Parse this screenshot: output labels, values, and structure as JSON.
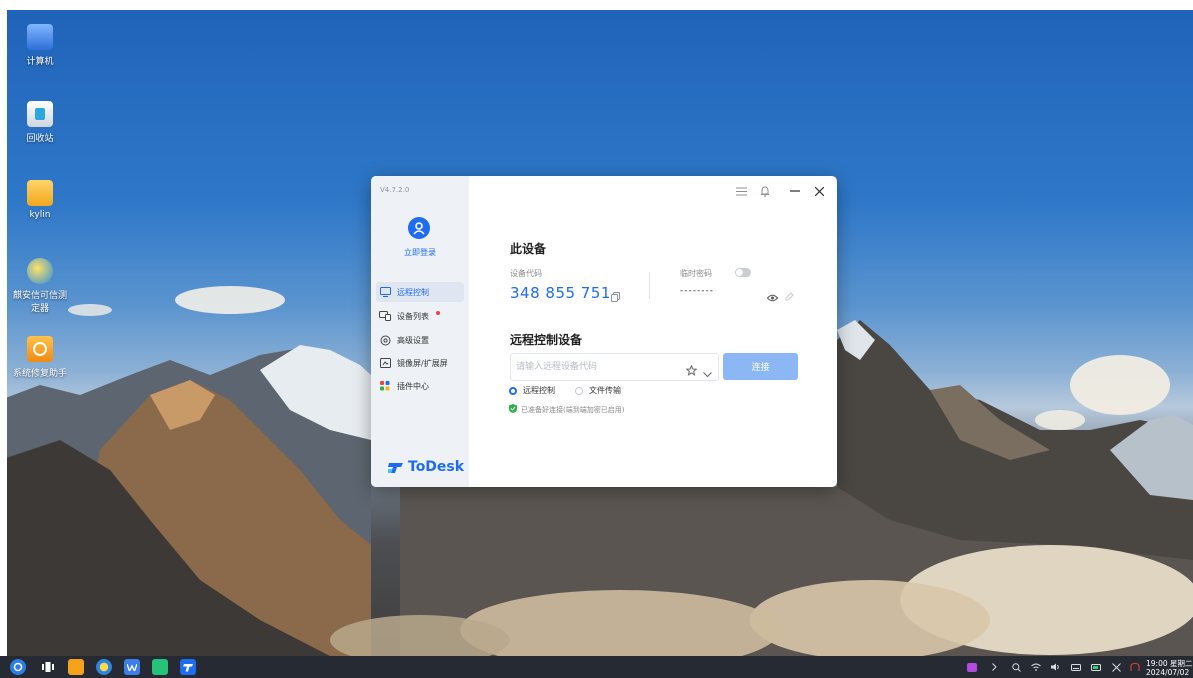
{
  "desktop": {
    "icons": [
      {
        "label": "计算机",
        "icon": "computer-icon"
      },
      {
        "label": "回收站",
        "icon": "trash-icon"
      },
      {
        "label": "kylin",
        "icon": "folder-icon"
      },
      {
        "label": "麒安信可信测定器",
        "icon": "kylin-security-icon"
      },
      {
        "label": "系统修复助手",
        "icon": "repair-icon"
      }
    ]
  },
  "todesk": {
    "version": "V4.7.2.0",
    "login_label": "立即登录",
    "nav": [
      {
        "label": "远程控制",
        "icon": "monitor-icon",
        "active": true
      },
      {
        "label": "设备列表",
        "icon": "devices-icon",
        "badge": true
      },
      {
        "label": "高级设置",
        "icon": "settings-icon"
      },
      {
        "label": "镜像屏/扩展屏",
        "icon": "mirror-icon"
      },
      {
        "label": "插件中心",
        "icon": "plugin-icon"
      }
    ],
    "brand": "ToDesk",
    "this_device": {
      "title": "此设备",
      "code_label": "设备代码",
      "code": "348 855 751",
      "temp_password_label": "临时密码",
      "password_mask": "--------",
      "temp_password_enabled": false
    },
    "remote": {
      "title": "远程控制设备",
      "input_placeholder": "请输入远程设备代码",
      "connect_label": "连接",
      "modes": [
        {
          "label": "远程控制",
          "selected": true
        },
        {
          "label": "文件传输",
          "selected": false
        }
      ],
      "status": "已准备好连接(端到端加密已启用)"
    },
    "colors": {
      "accent": "#1e6cf0",
      "connect_disabled": "#8bb8f4",
      "badge": "#f0433a",
      "status_ok": "#2bb24c"
    }
  },
  "taskbar": {
    "clock_time": "19:00 星期二",
    "clock_date": "2024/07/02"
  }
}
